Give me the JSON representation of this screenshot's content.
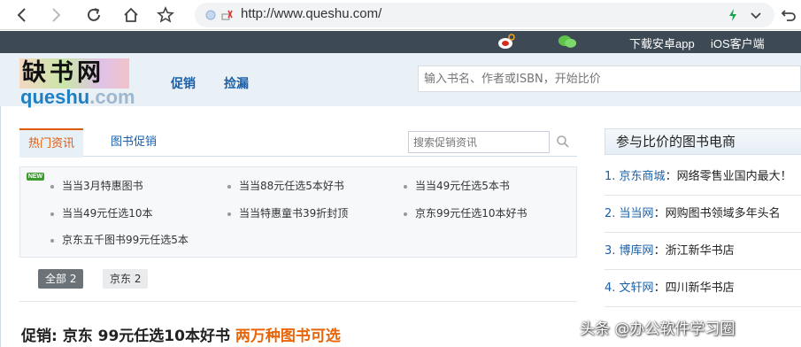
{
  "browser": {
    "url": "http://www.queshu.com/"
  },
  "topbar": {
    "android_link": "下载安卓app",
    "ios_link": "iOS客户端"
  },
  "header": {
    "logo_cn": "缺书网",
    "logo_en_main": "queshu",
    "logo_en_suffix": ".com",
    "nav": [
      "促销",
      "捡漏"
    ],
    "search_placeholder": "输入书名、作者或ISBN，开始比价"
  },
  "panel": {
    "tabs": [
      "热门资讯",
      "图书促销"
    ],
    "search_placeholder": "搜索促销资讯",
    "new_badge": "NEW",
    "news": [
      "当当3月特惠图书",
      "当当88元任选5本好书",
      "当当49元任选5本书",
      "当当49元任选10本",
      "当当特惠童书39折封顶",
      "京东99元任选10本好书",
      "京东五千图书99元任选5本"
    ],
    "filters": [
      "全部 2",
      "京东 2"
    ]
  },
  "promo": {
    "prefix": "促销: 京东 99元任选10本好书",
    "highlight": "两万种图书可选"
  },
  "sidebar": {
    "title": "参与比价的图书电商",
    "stores": [
      {
        "num": "1.",
        "name": "京东商城",
        "desc": "：网络零售业国内最大！"
      },
      {
        "num": "2.",
        "name": "当当网",
        "desc": "：网购图书领域多年头名"
      },
      {
        "num": "3.",
        "name": "博库网",
        "desc": "：浙江新华书店"
      },
      {
        "num": "4.",
        "name": "文轩网",
        "desc": "：四川新华书店"
      }
    ]
  },
  "watermark": "头条 @办公软件学习圈",
  "colors": {
    "topbar_bg": "#3d4a55",
    "link_blue": "#1a5fa8",
    "accent_orange": "#e8650a"
  }
}
